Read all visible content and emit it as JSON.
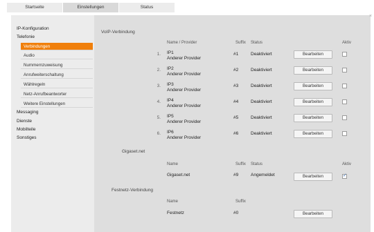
{
  "tabs": [
    "Startseite",
    "Einstellungen",
    "Status"
  ],
  "sidebar": {
    "items": [
      "IP-Konfiguration",
      "Telefonie",
      "Messaging",
      "Dienste",
      "Mobilteile",
      "Sonstiges"
    ],
    "telefonie_sub": [
      "Verbindungen",
      "Audio",
      "Nummernzuweisung",
      "Anrufweiterschaltung",
      "Wählregeln",
      "Netz-Anrufbeantworter",
      "Weitere Einstellungen"
    ],
    "active_sub": "Verbindungen"
  },
  "voip": {
    "title": "VoIP-Verbindung",
    "headers": {
      "name": "Name / Provider",
      "suffix": "Suffix",
      "status": "Status",
      "aktiv": "Aktiv"
    },
    "rows": [
      {
        "num": "1.",
        "name": "IP1",
        "provider": "Anderer Provider",
        "suffix": "#1",
        "status": "Deaktiviert",
        "button": "Bearbeiten",
        "active": false
      },
      {
        "num": "2.",
        "name": "IP2",
        "provider": "Anderer Provider",
        "suffix": "#2",
        "status": "Deaktiviert",
        "button": "Bearbeiten",
        "active": false
      },
      {
        "num": "3.",
        "name": "IP3",
        "provider": "Anderer Provider",
        "suffix": "#3",
        "status": "Deaktiviert",
        "button": "Bearbeiten",
        "active": false
      },
      {
        "num": "4.",
        "name": "IP4",
        "provider": "Anderer Provider",
        "suffix": "#4",
        "status": "Deaktiviert",
        "button": "Bearbeiten",
        "active": false
      },
      {
        "num": "5.",
        "name": "IP5",
        "provider": "Anderer Provider",
        "suffix": "#5",
        "status": "Deaktiviert",
        "button": "Bearbeiten",
        "active": false
      },
      {
        "num": "6.",
        "name": "IP6",
        "provider": "Anderer Provider",
        "suffix": "#6",
        "status": "Deaktiviert",
        "button": "Bearbeiten",
        "active": false
      }
    ]
  },
  "gigaset": {
    "title": "Gigaset.net",
    "headers": {
      "name": "Name",
      "suffix": "Suffix",
      "status": "Status",
      "aktiv": "Aktiv"
    },
    "row": {
      "name": "Gigaset.net",
      "suffix": "#9",
      "status": "Angemeldet",
      "button": "Bearbeiten",
      "active": true
    }
  },
  "festnetz": {
    "title": "Festnetz-Verbindung",
    "headers": {
      "name": "Name",
      "suffix": "Suffix"
    },
    "row": {
      "name": "Festnetz",
      "suffix": "#0",
      "button": "Bearbeiten"
    }
  },
  "colors": {
    "accent": "#f07f0b",
    "sidebar_bg": "#ececec",
    "content_bg": "#dedede"
  }
}
